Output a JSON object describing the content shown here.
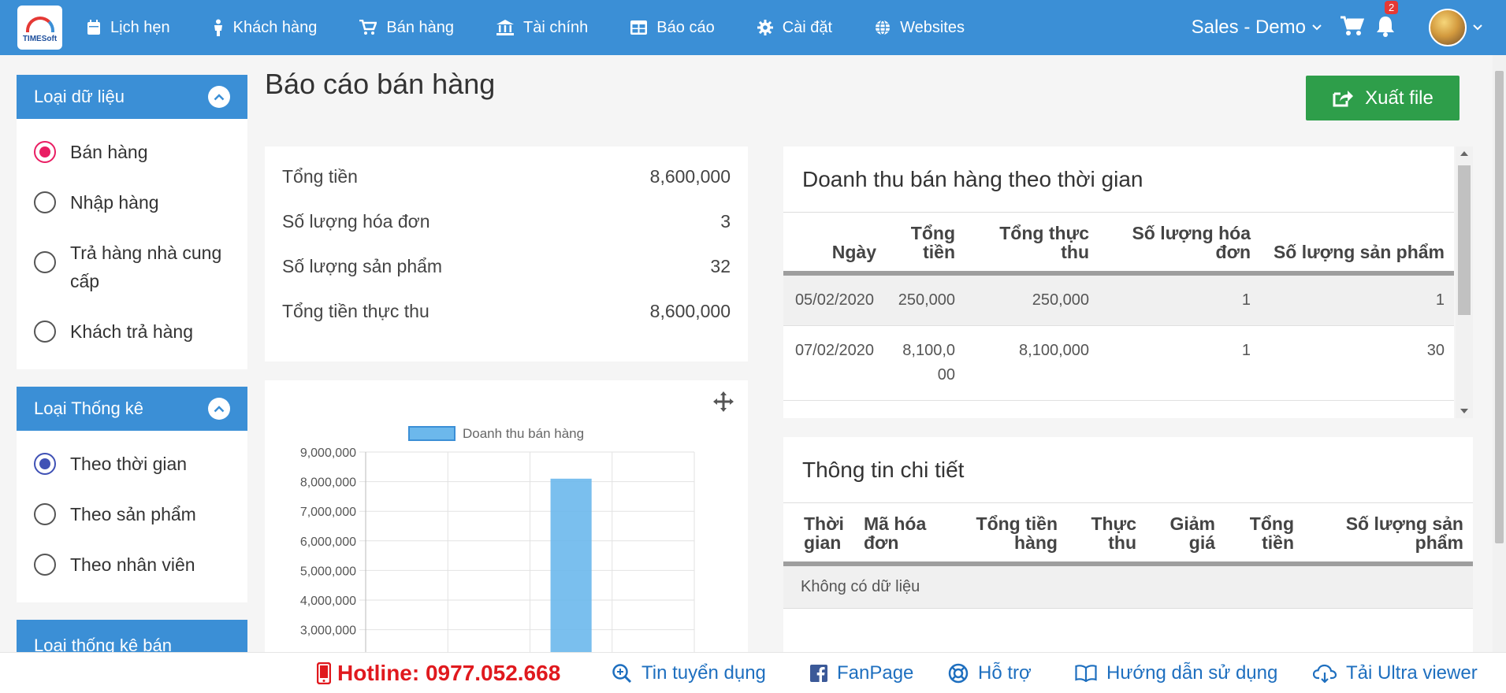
{
  "logo": {
    "text": "TIMESoft"
  },
  "nav": {
    "items": [
      {
        "label": "Lịch hẹn",
        "icon": "calendar-icon"
      },
      {
        "label": "Khách hàng",
        "icon": "person-icon"
      },
      {
        "label": "Bán hàng",
        "icon": "cart-icon"
      },
      {
        "label": "Tài chính",
        "icon": "bank-icon"
      },
      {
        "label": "Báo cáo",
        "icon": "table-icon"
      },
      {
        "label": "Cài đặt",
        "icon": "gear-icon"
      },
      {
        "label": "Websites",
        "icon": "globe-icon"
      }
    ],
    "store": "Sales - Demo",
    "notification_count": "2"
  },
  "sidebar": {
    "data_type": {
      "title": "Loại dữ liệu",
      "options": [
        "Bán hàng",
        "Nhập hàng",
        "Trả hàng nhà cung cấp",
        "Khách trả hàng"
      ],
      "selected": 0
    },
    "stat_type": {
      "title": "Loại Thống kê",
      "options": [
        "Theo thời gian",
        "Theo sản phẩm",
        "Theo nhân viên"
      ],
      "selected": 0
    },
    "sales_stat_type": {
      "title": "Loại thống kê bán hàng"
    }
  },
  "main": {
    "title": "Báo cáo bán hàng",
    "export_label": "Xuất file",
    "summary": [
      {
        "label": "Tổng tiền",
        "value": "8,600,000"
      },
      {
        "label": "Số lượng hóa đơn",
        "value": "3"
      },
      {
        "label": "Số lượng sản phẩm",
        "value": "32"
      },
      {
        "label": "Tổng tiền thực thu",
        "value": "8,600,000"
      }
    ]
  },
  "revenue_table": {
    "title": "Doanh thu bán hàng theo thời gian",
    "columns": [
      "Ngày",
      "Tổng tiền",
      "Tổng thực thu",
      "Số lượng hóa đơn",
      "Số lượng sản phẩm"
    ],
    "rows": [
      [
        "05/02/2020",
        "250,000",
        "250,000",
        "1",
        "1"
      ],
      [
        "07/02/2020",
        "8,100,000",
        "8,100,000",
        "1",
        "30"
      ]
    ]
  },
  "detail_table": {
    "title": "Thông tin chi tiết",
    "columns": [
      "Thời gian",
      "Mã hóa đơn",
      "Tổng tiền hàng",
      "Thực thu",
      "Giảm giá",
      "Tổng tiền",
      "Số lượng sản phẩm"
    ],
    "empty_text": "Không có dữ liệu"
  },
  "chart_data": {
    "type": "bar",
    "series": [
      {
        "name": "Doanh thu bán hàng",
        "values": [
          0,
          0,
          8100000,
          0
        ]
      }
    ],
    "categories": [
      "",
      "",
      "",
      ""
    ],
    "yticks": [
      "9,000,000",
      "8,000,000",
      "7,000,000",
      "6,000,000",
      "5,000,000",
      "4,000,000",
      "3,000,000"
    ],
    "ylim": [
      3000000,
      9000000
    ],
    "color": "#6cb8ec",
    "legend": "top"
  },
  "footer": {
    "hotline": "Hotline: 0977.052.668",
    "links": [
      "Tin tuyển dụng",
      "FanPage",
      "Hỗ trợ",
      "Hướng dẫn sử dụng",
      "Tải Ultra viewer"
    ]
  },
  "colors": {
    "primary": "#3b8fd6",
    "export": "#2e9e4a",
    "hotline": "#e0191e"
  }
}
